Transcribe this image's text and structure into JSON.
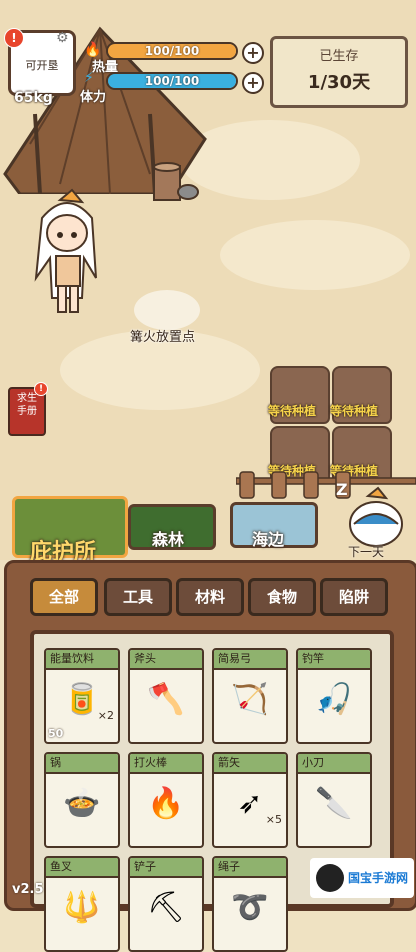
{
  "hud": {
    "pack_label": "可开垦",
    "alert_mark": "!",
    "weight": "65kg",
    "heat": {
      "label": "热量",
      "value": "100/100",
      "fill": 1.0,
      "color": "#f2a541"
    },
    "stamina": {
      "label": "体力",
      "value": "100/100",
      "fill": 1.0,
      "color": "#3ab0e0"
    },
    "plus": "+",
    "survived": {
      "title": "已生存",
      "days": "1/30天"
    }
  },
  "scene": {
    "fire_label": "篝火放置点",
    "manual": {
      "label_line1": "求生",
      "label_line2": "手册"
    },
    "plots": [
      "等待种植",
      "等待种植",
      "等待种植",
      "等待种植"
    ],
    "next_day": "下一天",
    "zzz": "Z"
  },
  "locations": [
    {
      "name": "庇护所",
      "color": "#6c8f3a"
    },
    {
      "name": "森林",
      "color": "#3f6d2f"
    },
    {
      "name": "海边",
      "color": "#9bc4d6"
    }
  ],
  "categories": [
    {
      "label": "全部",
      "active": true
    },
    {
      "label": "工具",
      "active": false
    },
    {
      "label": "材料",
      "active": false
    },
    {
      "label": "食物",
      "active": false
    },
    {
      "label": "陷阱",
      "active": false
    }
  ],
  "items": [
    {
      "name": "能量饮料",
      "qty": "×2",
      "badge": "50",
      "icon": "energy-drink-icon"
    },
    {
      "name": "斧头",
      "qty": "",
      "badge": "",
      "icon": "axe-icon"
    },
    {
      "name": "简易弓",
      "qty": "",
      "badge": "",
      "icon": "bow-icon"
    },
    {
      "name": "钓竿",
      "qty": "",
      "badge": "",
      "icon": "fishing-rod-icon"
    },
    {
      "name": "锅",
      "qty": "",
      "badge": "",
      "icon": "pot-icon"
    },
    {
      "name": "打火棒",
      "qty": "",
      "badge": "",
      "icon": "fire-stick-icon"
    },
    {
      "name": "箭矢",
      "qty": "×5",
      "badge": "",
      "icon": "arrow-icon"
    },
    {
      "name": "小刀",
      "qty": "",
      "badge": "",
      "icon": "knife-icon"
    },
    {
      "name": "鱼叉",
      "qty": "",
      "badge": "",
      "icon": "harpoon-icon"
    },
    {
      "name": "铲子",
      "qty": "",
      "badge": "",
      "icon": "shovel-icon"
    },
    {
      "name": "绳子",
      "qty": "",
      "badge": "",
      "icon": "rope-icon"
    }
  ],
  "version": "v2.5",
  "watermark": "国宝手游网"
}
